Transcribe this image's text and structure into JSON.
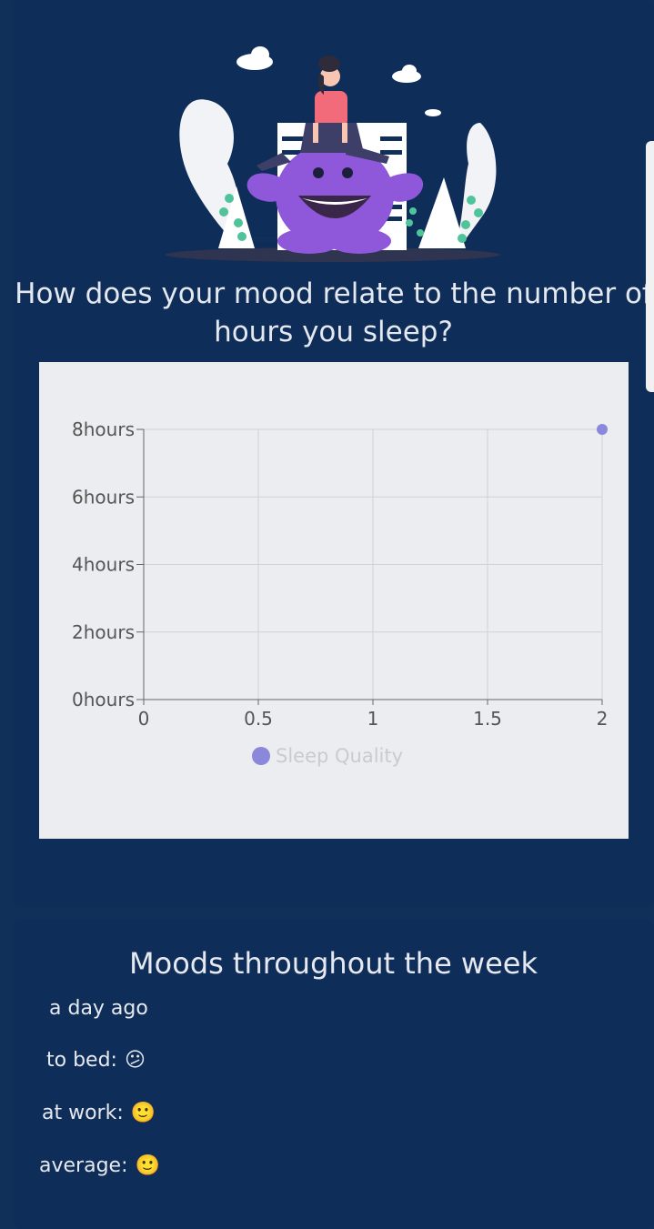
{
  "sleep_card": {
    "title": "How does your mood relate to the number of hours you sleep?"
  },
  "chart_data": {
    "type": "scatter",
    "series": [
      {
        "name": "Sleep Quality",
        "color": "#8b87da",
        "points": [
          {
            "x": 2,
            "y": 8
          }
        ]
      }
    ],
    "x_ticks": [
      "0",
      "0.5",
      "1",
      "1.5",
      "2"
    ],
    "y_ticks": [
      "0hours",
      "2hours",
      "4hours",
      "6hours",
      "8hours"
    ],
    "xlim": [
      0,
      2
    ],
    "ylim": [
      0,
      8
    ],
    "grid": true,
    "legend_position": "bottom"
  },
  "week_card": {
    "title": "Moods throughout the week",
    "day": "a day ago",
    "entries": [
      {
        "label": "to bed:",
        "emoji": "😕"
      },
      {
        "label": "at work:",
        "emoji": "🙂"
      },
      {
        "label": "average:",
        "emoji": "🙂"
      }
    ]
  },
  "colors": {
    "background": "#10305a",
    "card": "#0f2d59",
    "chart_bg": "#ebedf0",
    "accent": "#8b87da",
    "monster": "#8f57d9",
    "shirt": "#f26b7b"
  }
}
